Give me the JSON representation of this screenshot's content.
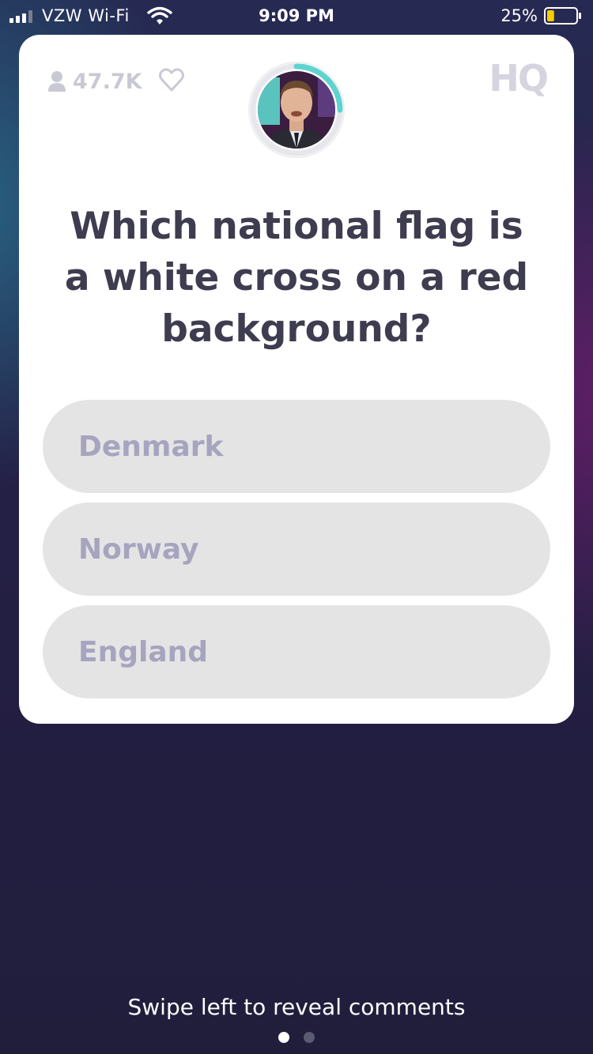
{
  "status_bar": {
    "carrier": "VZW Wi-Fi",
    "time": "9:09 PM",
    "battery_percent": "25%",
    "battery_level": 0.25,
    "signal_icon": "cellular-signal-icon",
    "wifi_icon": "wifi-icon",
    "battery_icon": "battery-icon"
  },
  "header": {
    "viewer_count": "47.7K",
    "viewer_icon": "person-icon",
    "heart_icon": "heart-icon",
    "logo_text": "HQ",
    "timer_progress": 0.25
  },
  "question": {
    "text": "Which national flag is a white cross on a red background?"
  },
  "answers": [
    {
      "label": "Denmark"
    },
    {
      "label": "Norway"
    },
    {
      "label": "England"
    }
  ],
  "footer": {
    "swipe_hint": "Swipe left to reveal comments",
    "page_indicator": {
      "current": 1,
      "total": 2
    }
  },
  "colors": {
    "card_background": "#ffffff",
    "question_text": "#3e3c4f",
    "answer_background": "#e4e4e5",
    "answer_text": "#a6a4be",
    "timer_ring": "#5fd3d0",
    "battery_fill": "#ffcc00"
  }
}
